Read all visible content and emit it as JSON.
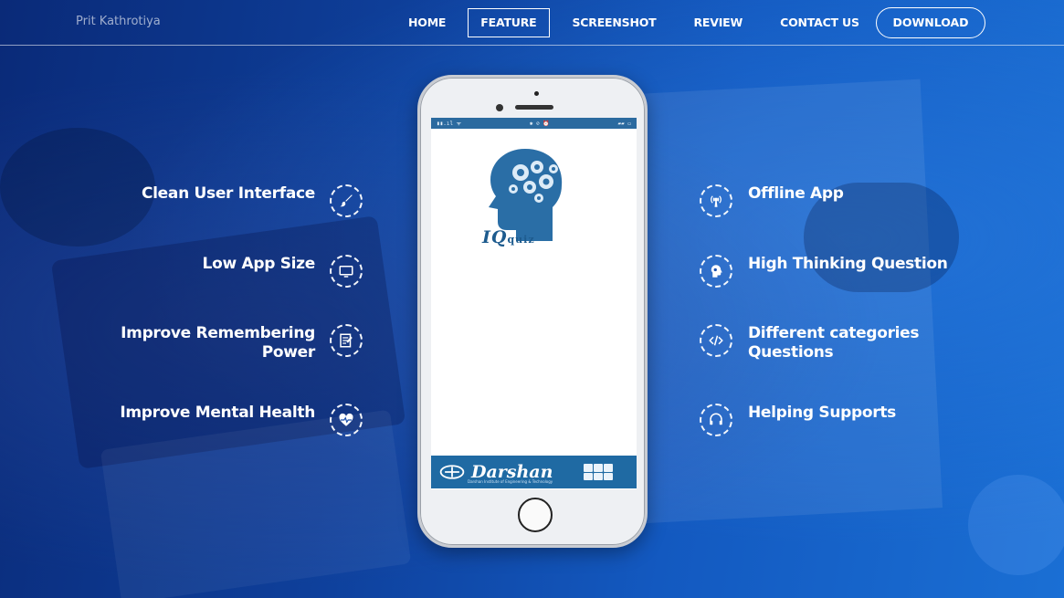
{
  "nav": {
    "brand": "Prit Kathrotiya",
    "items": [
      {
        "label": "HOME",
        "active": false
      },
      {
        "label": "FEATURE",
        "active": true
      },
      {
        "label": "SCREENSHOT",
        "active": false
      },
      {
        "label": "REVIEW",
        "active": false
      },
      {
        "label": "CONTACT US",
        "active": false
      }
    ],
    "download_label": "DOWNLOAD"
  },
  "features": {
    "left": [
      {
        "label": "Clean User Interface",
        "icon": "brush-icon"
      },
      {
        "label": "Low App Size",
        "icon": "monitor-icon"
      },
      {
        "label": "Improve Remembering Power",
        "line1": "Improve Remembering",
        "line2": "Power",
        "icon": "notepad-icon"
      },
      {
        "label": "Improve Mental Health",
        "icon": "heartbeat-icon"
      }
    ],
    "right": [
      {
        "label": "Offline App",
        "icon": "broadcast-icon"
      },
      {
        "label": "High Thinking Question",
        "icon": "brain-head-icon"
      },
      {
        "label": "Different categories Questions",
        "line1": "Different categories",
        "line2": "Questions",
        "icon": "code-icon"
      },
      {
        "label": "Helping Supports",
        "icon": "headset-icon"
      }
    ]
  },
  "phone": {
    "app_logo_text": "IQ",
    "app_logo_sub": "quiz",
    "banner_title": "Darshan",
    "banner_subtitle": "Darshan Institute of Engineering & Technology"
  },
  "colors": {
    "bg_dark": "#0a2a78",
    "bg_light": "#1a6fd4",
    "app_blue": "#1f6aa3"
  }
}
